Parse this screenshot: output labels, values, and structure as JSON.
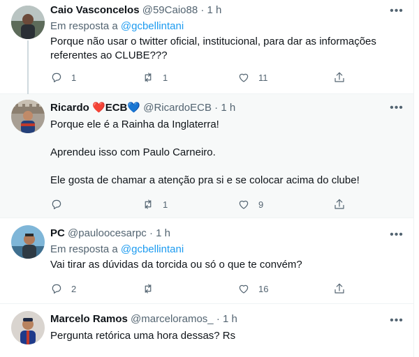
{
  "tweets": [
    {
      "name": "Caio Vasconcelos",
      "handle": "@59Caio88",
      "dot": "·",
      "time": "1 h",
      "reply_prefix": "Em resposta a",
      "reply_to": "@gcbellintani",
      "text": [
        "Porque não usar o twitter oficial, institucional, para dar as informações referentes ao CLUBE???"
      ],
      "replies": "1",
      "retweets": "1",
      "likes": "11"
    },
    {
      "name_part1": "Ricardo ",
      "name_heart": "❤️",
      "name_part2": "ECB",
      "name_blue_heart": "💙",
      "handle": "@RicardoECB",
      "dot": "·",
      "time": "1 h",
      "text": [
        "Porque ele é a Rainha da Inglaterra!",
        "Aprendeu isso com Paulo Carneiro.",
        "Ele gosta de chamar a atenção pra si e se colocar acima do clube!"
      ],
      "replies": "",
      "retweets": "1",
      "likes": "9"
    },
    {
      "name": "PC",
      "handle": "@pauloocesarpc",
      "dot": "·",
      "time": "1 h",
      "reply_prefix": "Em resposta a",
      "reply_to": "@gcbellintani",
      "text": [
        "Vai tirar as dúvidas da torcida ou só o que te convém?"
      ],
      "replies": "2",
      "retweets": "",
      "likes": "16"
    },
    {
      "name": "Marcelo Ramos",
      "handle": "@marceloramos_",
      "dot": "·",
      "time": "1 h",
      "text": [
        "Pergunta retórica uma hora dessas? Rs"
      ]
    }
  ],
  "icons": {
    "more": "more-icon",
    "reply": "reply-icon",
    "retweet": "retweet-icon",
    "like": "heart-icon",
    "share": "share-icon"
  },
  "colors": {
    "link": "#1d9bf0",
    "secondary": "#536471",
    "highlight_bg": "#f7f9f9"
  }
}
